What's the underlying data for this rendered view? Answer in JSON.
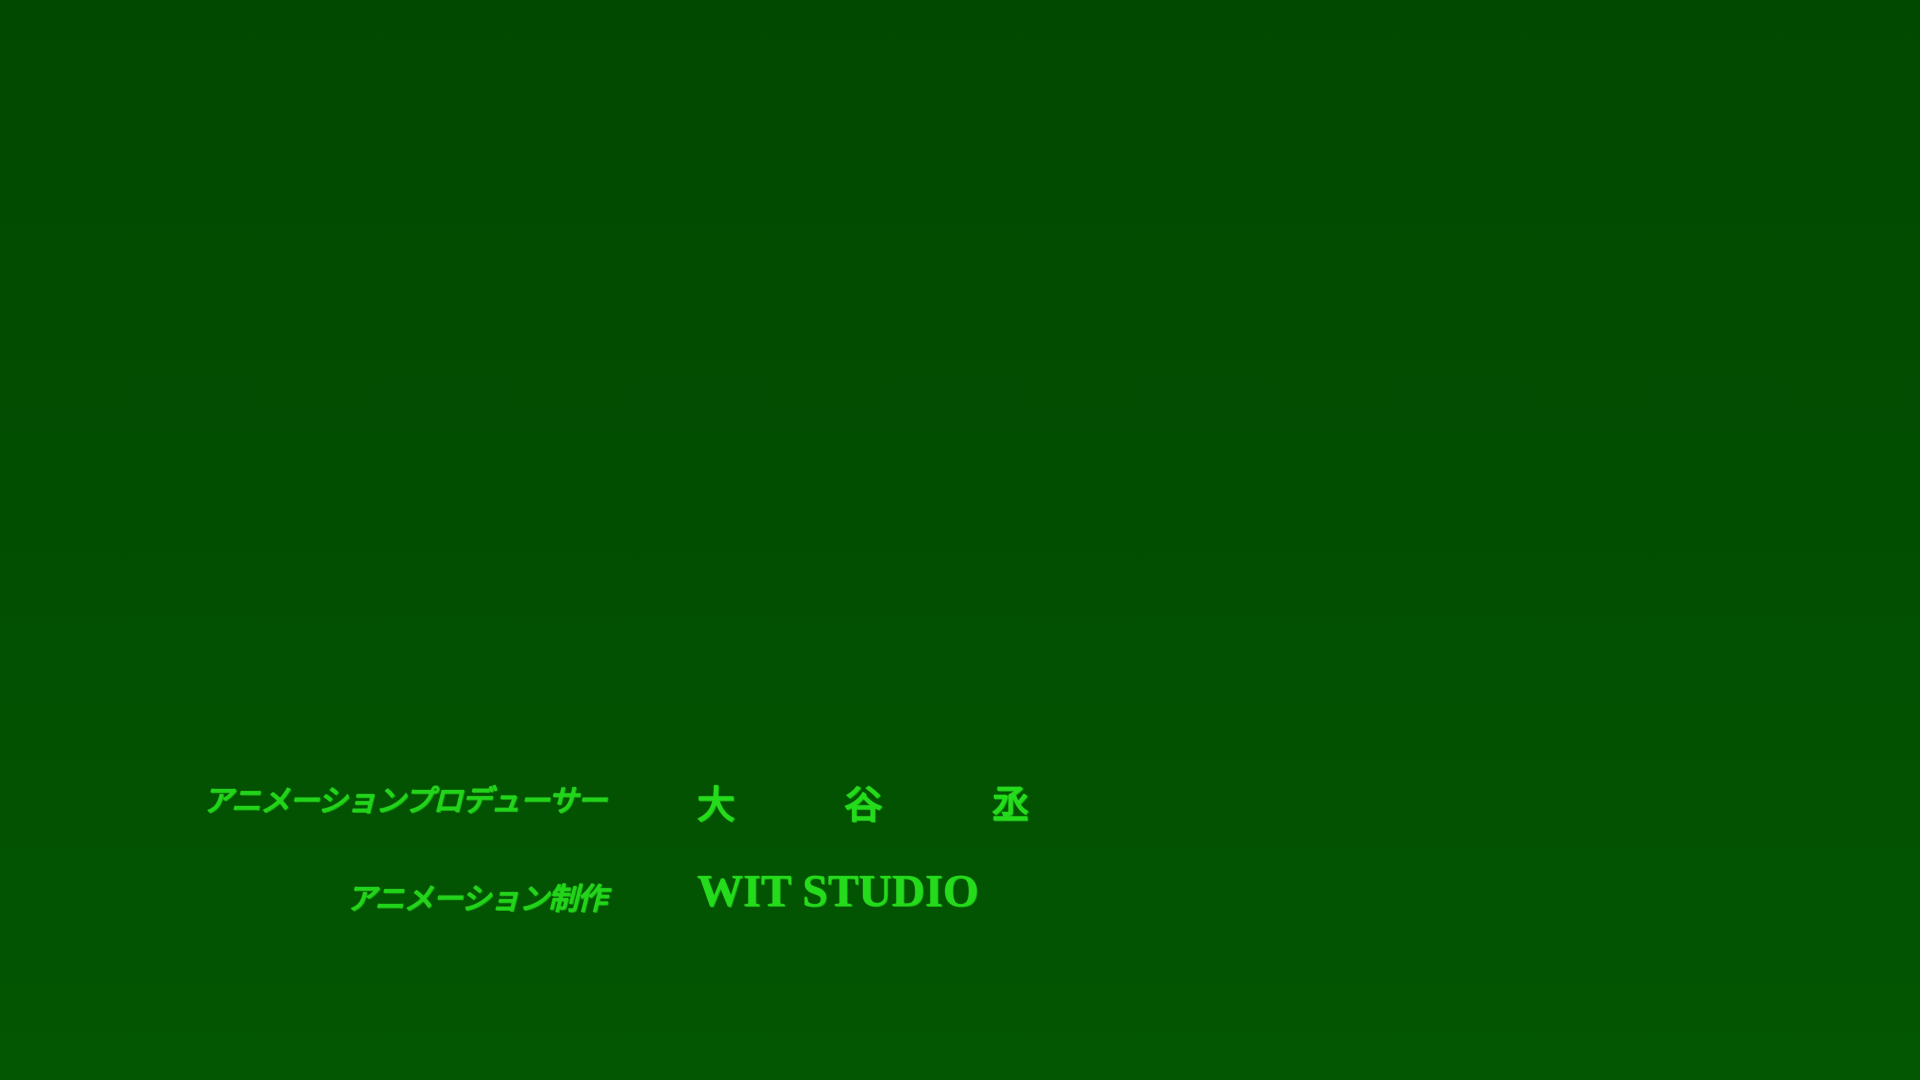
{
  "credits": [
    {
      "role": "アニメーションプロデューサー",
      "name": "大 谷  丞"
    },
    {
      "role": "アニメーション制作",
      "name": "WIT STUDIO"
    }
  ]
}
